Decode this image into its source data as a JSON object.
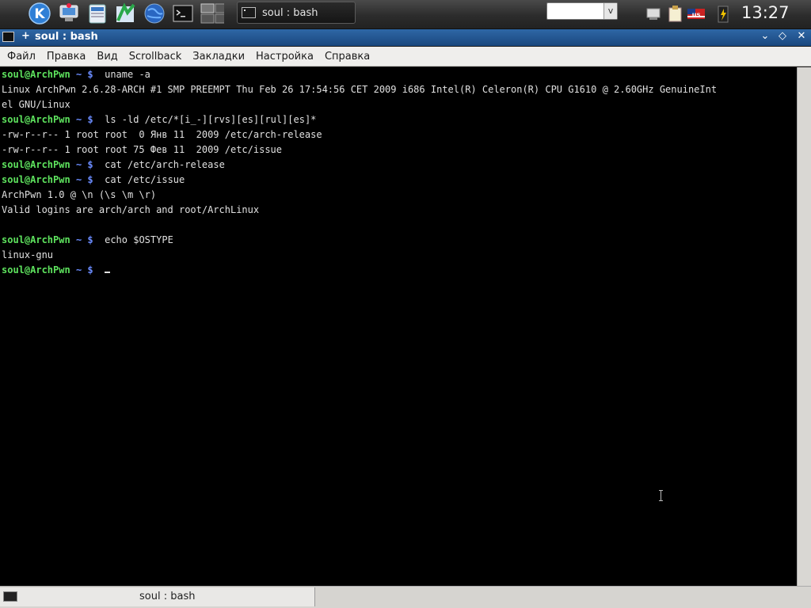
{
  "panel": {
    "icons": [
      "kde-menu-icon",
      "desktop-icon",
      "file-manager-icon",
      "kate-icon",
      "browser-icon",
      "konsole-icon",
      "pager-icon"
    ],
    "task_label": "soul : bash",
    "clock": "13:27",
    "tray_icons": [
      "network-icon",
      "klipper-icon",
      "keyboard-layout-icon",
      "battery-icon"
    ]
  },
  "window": {
    "title": "soul : bash",
    "pin_symbol": "+",
    "buttons": {
      "minimize": "⌄",
      "maximize": "◇",
      "close": "✕"
    }
  },
  "menu": {
    "items": [
      "Файл",
      "Правка",
      "Вид",
      "Scrollback",
      "Закладки",
      "Настройка",
      "Справка"
    ]
  },
  "terminal": {
    "user_host": "soul@ArchPwn",
    "tilde": "~",
    "dollar": "$",
    "lines": [
      {
        "prompt": true,
        "cmd": "uname -a"
      },
      {
        "prompt": false,
        "text": "Linux ArchPwn 2.6.28-ARCH #1 SMP PREEMPT Thu Feb 26 17:54:56 CET 2009 i686 Intel(R) Celeron(R) CPU G1610 @ 2.60GHz GenuineInt"
      },
      {
        "prompt": false,
        "text": "el GNU/Linux"
      },
      {
        "prompt": true,
        "cmd": "ls -ld /etc/*[i_-][rvs][es][rul][es]*"
      },
      {
        "prompt": false,
        "text": "-rw-r--r-- 1 root root  0 Янв 11  2009 /etc/arch-release"
      },
      {
        "prompt": false,
        "text": "-rw-r--r-- 1 root root 75 Фев 11  2009 /etc/issue"
      },
      {
        "prompt": true,
        "cmd": "cat /etc/arch-release"
      },
      {
        "prompt": true,
        "cmd": "cat /etc/issue"
      },
      {
        "prompt": false,
        "text": "ArchPwn 1.0 @ \\n (\\s \\m \\r)"
      },
      {
        "prompt": false,
        "text": "Valid logins are arch/arch and root/ArchLinux"
      },
      {
        "prompt": false,
        "text": ""
      },
      {
        "prompt": true,
        "cmd": "echo $OSTYPE"
      },
      {
        "prompt": false,
        "text": "linux-gnu"
      },
      {
        "prompt": true,
        "cmd": "",
        "cursor": true
      }
    ]
  },
  "tabs": [
    {
      "label": "soul : bash"
    }
  ]
}
